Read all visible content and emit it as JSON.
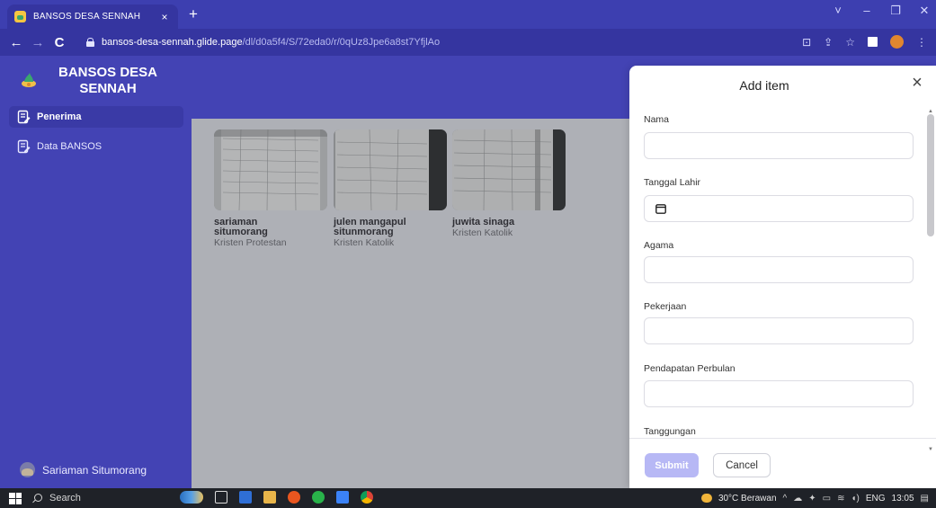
{
  "browser": {
    "tab_title": "BANSOS DESA SENNAH",
    "tab_close": "×",
    "new_tab": "+",
    "url_host": "bansos-desa-sennah.glide.page",
    "url_path": "/dl/d0a5f4/S/72eda0/r/0qUz8Jpe6a8st7YfjlAo",
    "window_controls": [
      "˅",
      "–",
      "❐",
      "✕"
    ],
    "icons": [
      "back-arrow-icon",
      "forward-arrow-icon",
      "reload-icon",
      "lock-icon",
      "install-app-icon",
      "share-icon",
      "bookmark-star-icon",
      "extension-icon",
      "profile-icon"
    ]
  },
  "sidebar": {
    "brand_title_line1": "BANSOS DESA",
    "brand_title_line2": "SENNAH",
    "items": [
      {
        "label": "Penerima",
        "active": true
      },
      {
        "label": "Data BANSOS",
        "active": false
      }
    ],
    "user_name": "Sariaman Situmorang"
  },
  "cards": [
    {
      "name_line1": "sariaman",
      "name_line2": "situmorang",
      "religion": "Kristen Protestan"
    },
    {
      "name_line1": "julen mangapul",
      "name_line2": "situnmorang",
      "religion": "Kristen Katolik"
    },
    {
      "name_line1": "juwita sinaga",
      "name_line2": "",
      "religion": "Kristen Katolik"
    }
  ],
  "modal": {
    "title": "Add item",
    "close": "×",
    "fields": [
      {
        "label": "Nama",
        "value": "",
        "type": "text"
      },
      {
        "label": "Tanggal Lahir",
        "value": "",
        "type": "date"
      },
      {
        "label": "Agama",
        "value": "",
        "type": "text"
      },
      {
        "label": "Pekerjaan",
        "value": "",
        "type": "text"
      },
      {
        "label": "Pendapatan Perbulan",
        "value": "",
        "type": "text"
      },
      {
        "label": "Tanggungan",
        "value": "",
        "type": "text"
      }
    ],
    "submit_label": "Submit",
    "cancel_label": "Cancel"
  },
  "taskbar": {
    "search_label": "Search",
    "weather": "30°C Berawan",
    "language": "ENG",
    "time": "13:05"
  },
  "colors": {
    "primary": "#4343b4",
    "browser_bar": "#3535a0",
    "submit_disabled": "#b7b8f5",
    "content_bg": "#aeb0b6"
  }
}
